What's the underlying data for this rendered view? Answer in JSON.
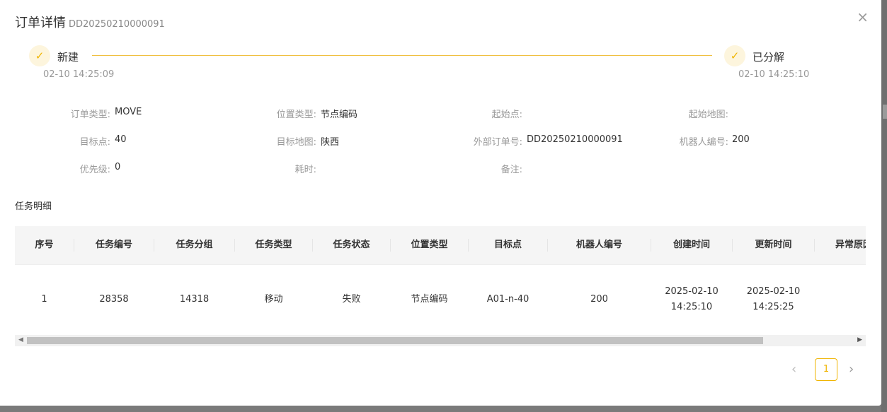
{
  "header": {
    "title": "订单详情",
    "order_id": "DD20250210000091",
    "close_symbol": "×"
  },
  "steps": [
    {
      "label": "新建",
      "time": "02-10 14:25:09",
      "icon": "check-icon"
    },
    {
      "label": "已分解",
      "time": "02-10 14:25:10",
      "icon": "check-icon"
    }
  ],
  "info": {
    "order_type": {
      "label": "订单类型:",
      "value": "MOVE"
    },
    "location_type": {
      "label": "位置类型:",
      "value": "节点编码"
    },
    "start_point": {
      "label": "起始点:",
      "value": ""
    },
    "start_map": {
      "label": "起始地图:",
      "value": ""
    },
    "target_point": {
      "label": "目标点:",
      "value": "40"
    },
    "target_map": {
      "label": "目标地图:",
      "value": "陕西"
    },
    "external_order": {
      "label": "外部订单号:",
      "value": "DD20250210000091"
    },
    "robot_no": {
      "label": "机器人编号:",
      "value": "200"
    },
    "priority": {
      "label": "优先级:",
      "value": "0"
    },
    "duration": {
      "label": "耗时:",
      "value": ""
    },
    "remark": {
      "label": "备注:",
      "value": ""
    }
  },
  "section_title": "任务明细",
  "table": {
    "columns": [
      "序号",
      "任务编号",
      "任务分组",
      "任务类型",
      "任务状态",
      "位置类型",
      "目标点",
      "机器人编号",
      "创建时间",
      "更新时间",
      "异常原因"
    ],
    "rows": [
      {
        "seq": "1",
        "task_no": "28358",
        "task_group": "14318",
        "task_type": "移动",
        "task_status": "失败",
        "location_type": "节点编码",
        "target": "A01-n-40",
        "robot_no": "200",
        "created_date": "2025-02-10",
        "created_time": "14:25:10",
        "updated_date": "2025-02-10",
        "updated_time": "14:25:25",
        "error_reason": ""
      }
    ]
  },
  "pagination": {
    "current": "1",
    "prev_symbol": "‹",
    "next_symbol": "›"
  },
  "colors": {
    "accent": "#f0b400",
    "accent_bg": "#fdf5dd",
    "line": "#f0c040"
  }
}
